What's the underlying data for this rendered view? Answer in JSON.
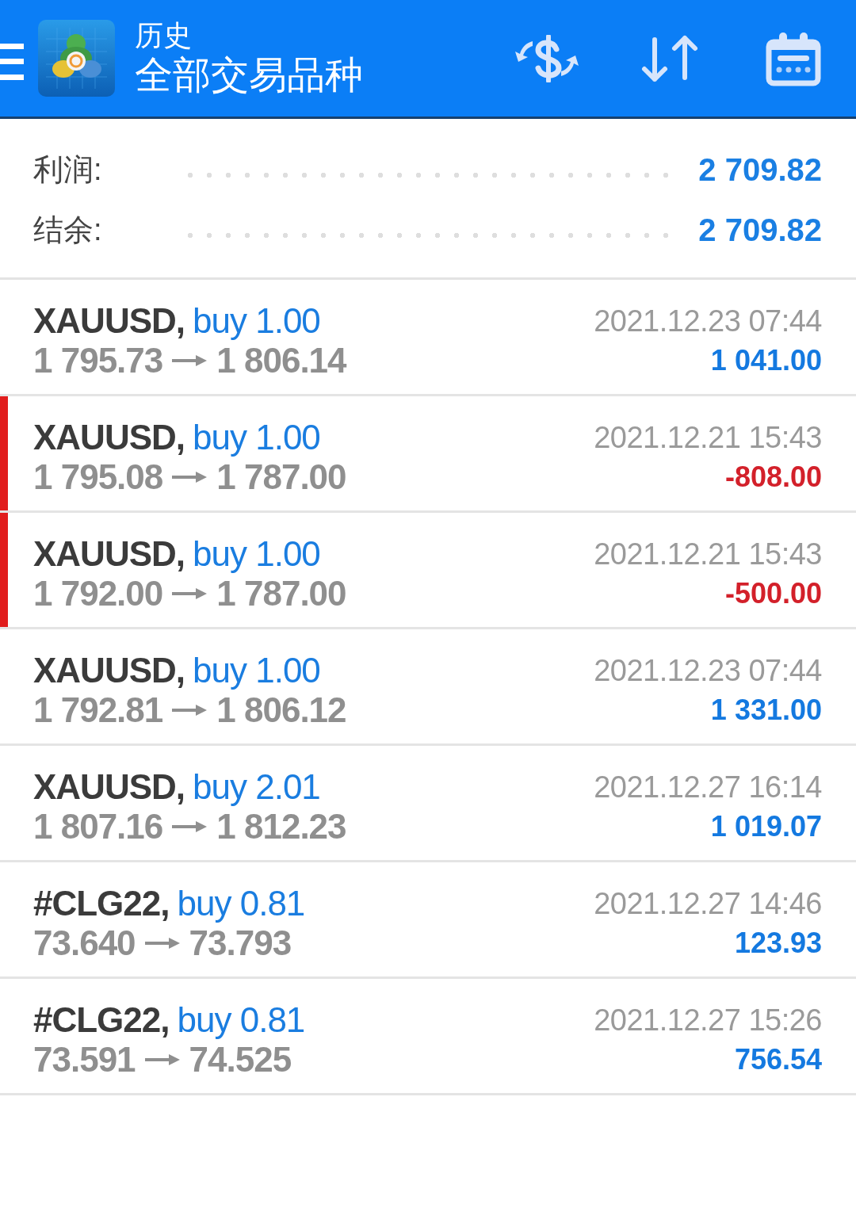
{
  "header": {
    "subtitle": "历史",
    "title": "全部交易品种"
  },
  "summary": [
    {
      "label": "利润:",
      "value": "2 709.82"
    },
    {
      "label": "结余:",
      "value": "2 709.82"
    }
  ],
  "trades": [
    {
      "symbol": "XAUUSD,",
      "order": "buy 1.00",
      "open_price": "1 795.73",
      "close_price": "1 806.14",
      "time": "2021.12.23 07:44",
      "profit": "1 041.00",
      "loss": false
    },
    {
      "symbol": "XAUUSD,",
      "order": "buy 1.00",
      "open_price": "1 795.08",
      "close_price": "1 787.00",
      "time": "2021.12.21 15:43",
      "profit": "-808.00",
      "loss": true
    },
    {
      "symbol": "XAUUSD,",
      "order": "buy 1.00",
      "open_price": "1 792.00",
      "close_price": "1 787.00",
      "time": "2021.12.21 15:43",
      "profit": "-500.00",
      "loss": true
    },
    {
      "symbol": "XAUUSD,",
      "order": "buy 1.00",
      "open_price": "1 792.81",
      "close_price": "1 806.12",
      "time": "2021.12.23 07:44",
      "profit": "1 331.00",
      "loss": false
    },
    {
      "symbol": "XAUUSD,",
      "order": "buy 2.01",
      "open_price": "1 807.16",
      "close_price": "1 812.23",
      "time": "2021.12.27 16:14",
      "profit": "1 019.07",
      "loss": false
    },
    {
      "symbol": "#CLG22,",
      "order": "buy 0.81",
      "open_price": "73.640",
      "close_price": "73.793",
      "time": "2021.12.27 14:46",
      "profit": "123.93",
      "loss": false
    },
    {
      "symbol": "#CLG22,",
      "order": "buy 0.81",
      "open_price": "73.591",
      "close_price": "74.525",
      "time": "2021.12.27 15:26",
      "profit": "756.54",
      "loss": false
    }
  ]
}
